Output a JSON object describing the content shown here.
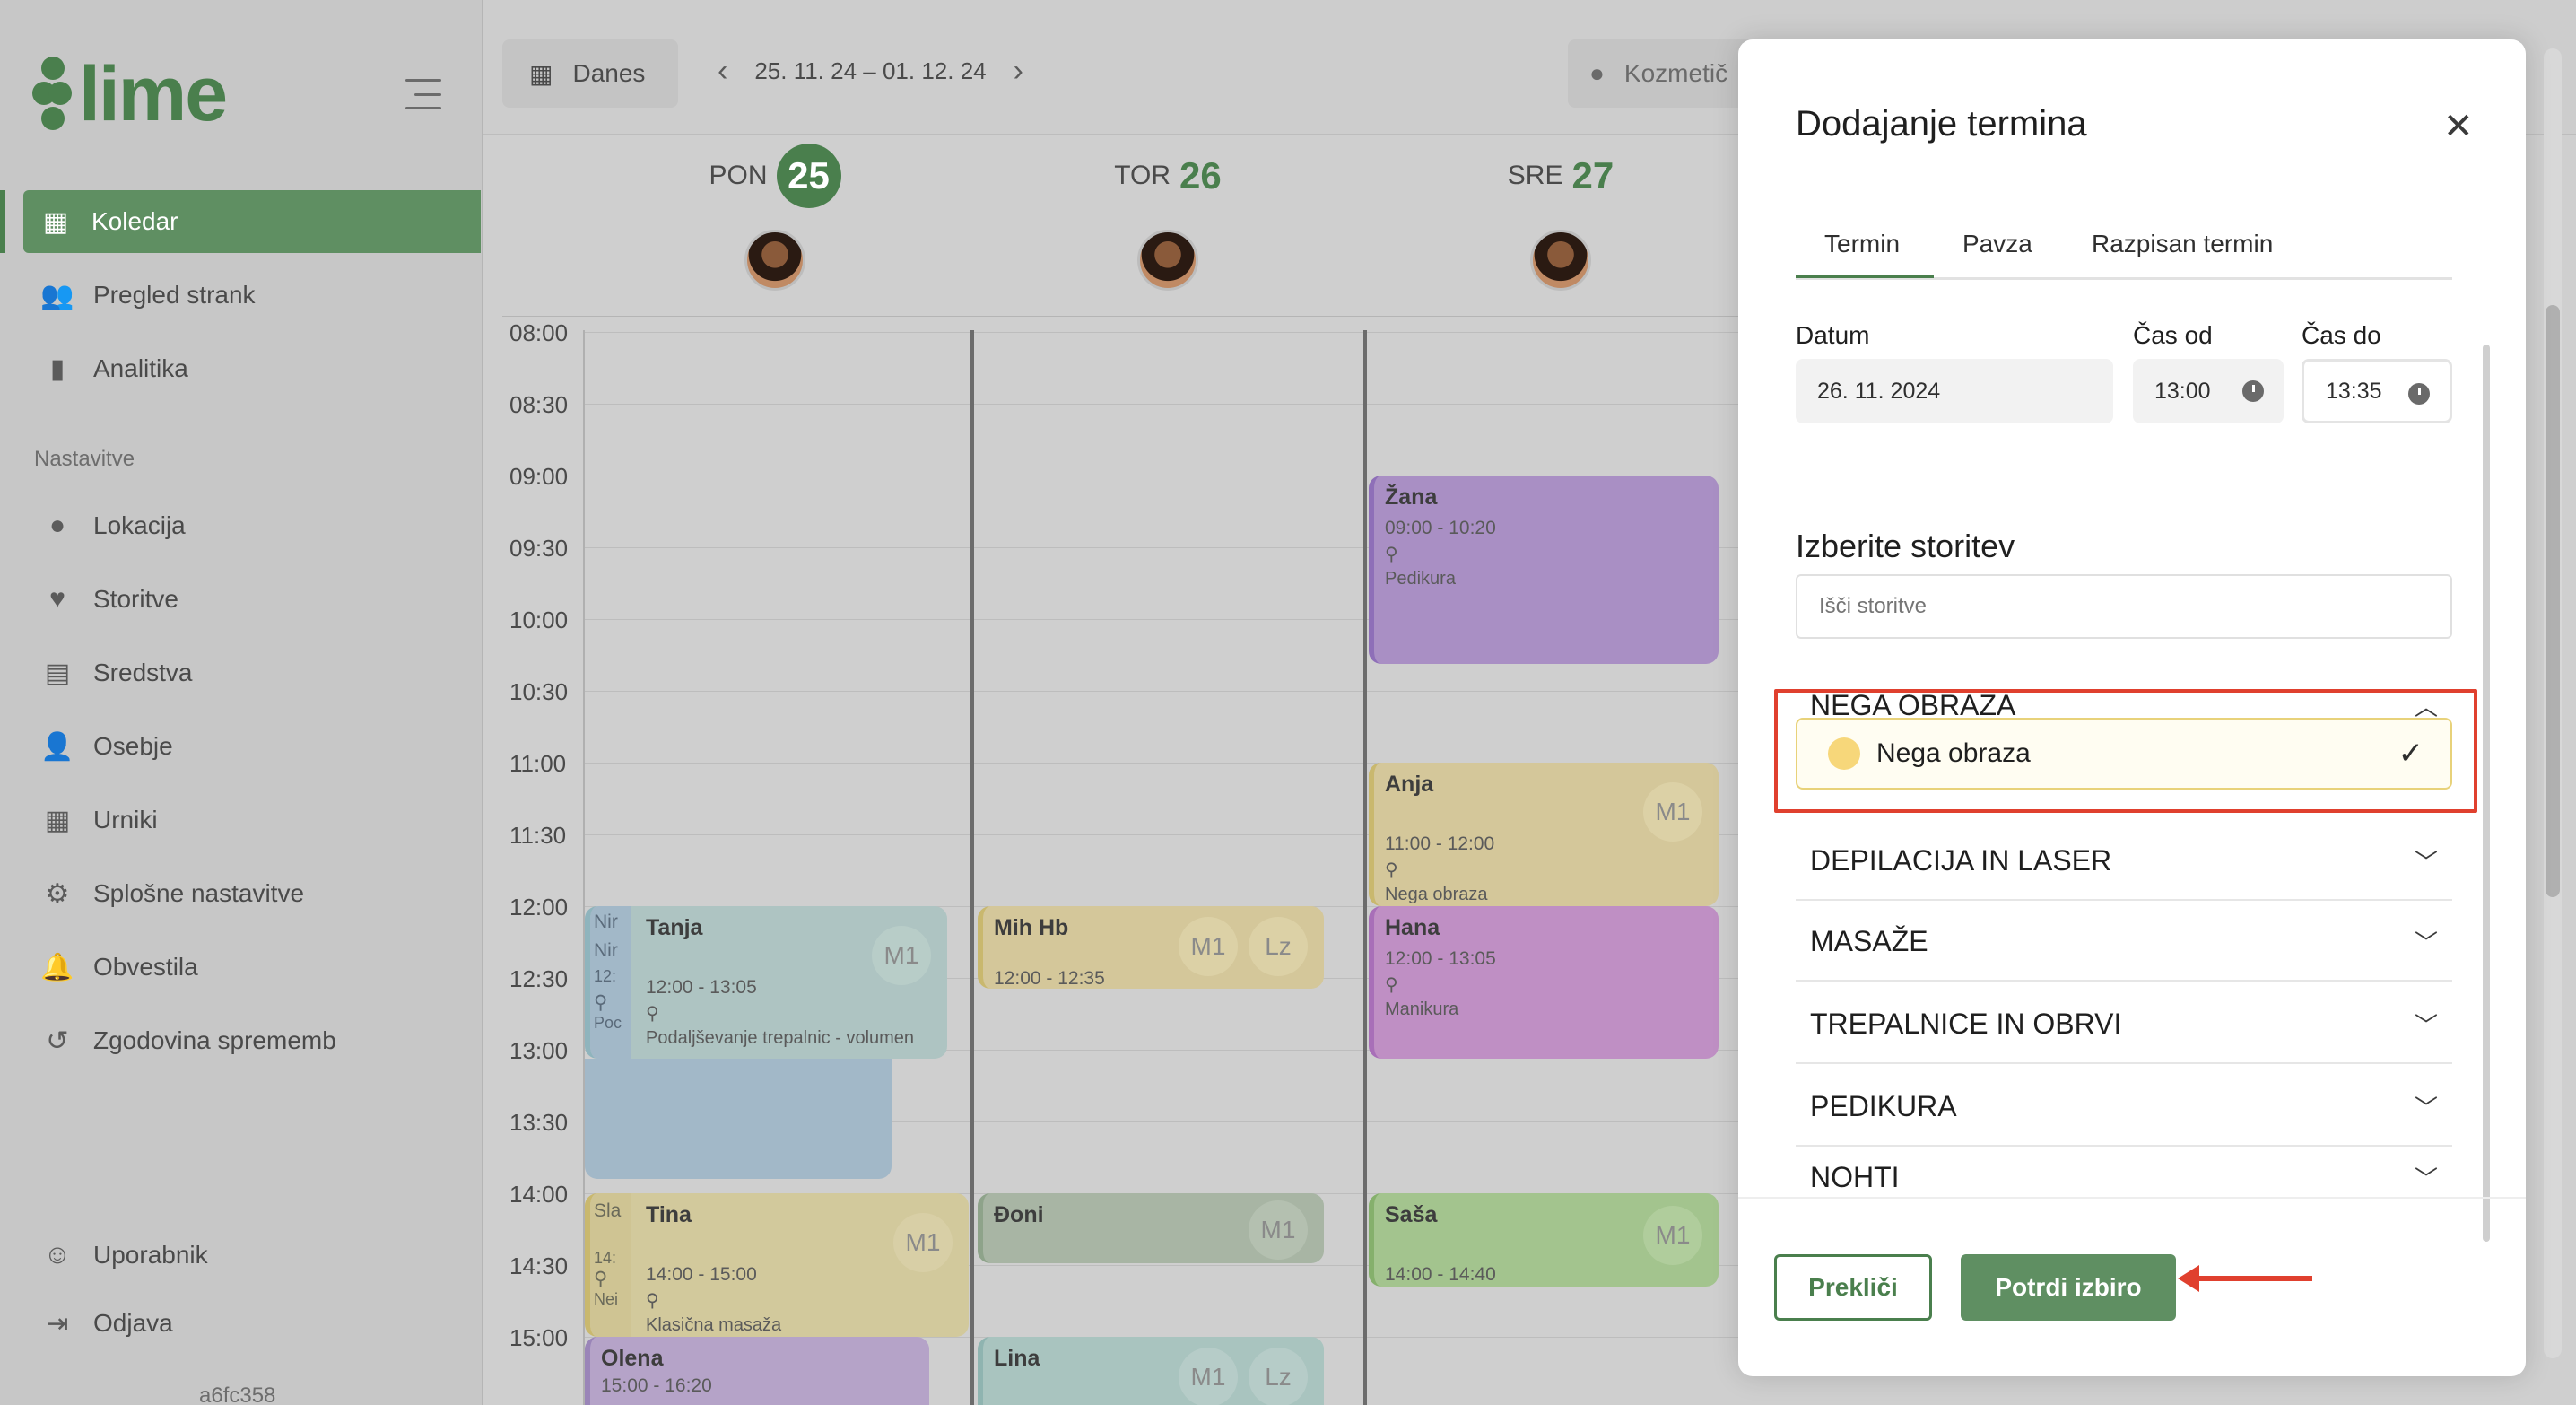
{
  "app": {
    "logo_text": "lime",
    "version": "a6fc358",
    "brand_color": "#4a7f4d"
  },
  "sidebar": {
    "items": [
      {
        "label": "Koledar",
        "icon": "calendar-icon",
        "active": true
      },
      {
        "label": "Pregled strank",
        "icon": "users-icon"
      },
      {
        "label": "Analitika",
        "icon": "bar-chart-icon"
      }
    ],
    "section_label": "Nastavitve",
    "settings_items": [
      {
        "label": "Lokacija",
        "icon": "location-pin-icon"
      },
      {
        "label": "Storitve",
        "icon": "heart-hand-icon"
      },
      {
        "label": "Sredstva",
        "icon": "building-icon"
      },
      {
        "label": "Osebje",
        "icon": "user-plus-icon"
      },
      {
        "label": "Urniki",
        "icon": "schedule-icon"
      },
      {
        "label": "Splošne nastavitve",
        "icon": "gear-icon"
      },
      {
        "label": "Obvestila",
        "icon": "bell-icon"
      },
      {
        "label": "Zgodovina sprememb",
        "icon": "history-icon"
      }
    ],
    "bottom_items": [
      {
        "label": "Uporabnik",
        "icon": "user-icon"
      },
      {
        "label": "Odjava",
        "icon": "logout-icon"
      }
    ]
  },
  "toolbar": {
    "today_label": "Danes",
    "date_range": "25. 11. 24 – 01. 12. 24",
    "location_label": "Kozmetič"
  },
  "days": [
    {
      "name": "PON",
      "num": "25",
      "today": true
    },
    {
      "name": "TOR",
      "num": "26",
      "today": false
    },
    {
      "name": "SRE",
      "num": "27",
      "today": false
    }
  ],
  "times": [
    "08:00",
    "08:30",
    "09:00",
    "09:30",
    "10:00",
    "10:30",
    "11:00",
    "11:30",
    "12:00",
    "12:30",
    "13:00",
    "13:30",
    "14:00",
    "14:30",
    "15:00"
  ],
  "events": {
    "zana": {
      "name": "Žana",
      "time": "09:00 - 10:20",
      "service": "Pedikura"
    },
    "anja": {
      "name": "Anja",
      "time": "11:00 - 12:00",
      "service": "Nega obraza",
      "tag": "M1"
    },
    "hana": {
      "name": "Hana",
      "time": "12:00 - 13:05",
      "service": "Manikura"
    },
    "sasa": {
      "name": "Saša",
      "time": "14:00 - 14:40",
      "tag": "M1"
    },
    "tanja": {
      "name": "Tanja",
      "time": "12:00 - 13:05",
      "service": "Podaljševanje trepalnic - volumen",
      "tag": "M1"
    },
    "tanja_overlap": {
      "name_a": "Nir",
      "name_b": "Nir",
      "time": "12:",
      "service": "Poc"
    },
    "tina": {
      "name": "Tina",
      "time": "14:00 - 15:00",
      "service": "Klasična masaža",
      "tag": "M1"
    },
    "tina_overlap": {
      "name": "Sla",
      "time": "14:",
      "service": "Nei"
    },
    "olena": {
      "name": "Olena",
      "time": "15:00 - 16:20"
    },
    "mihhb": {
      "name": "Mih Hb",
      "time": "12:00 - 12:35",
      "tag": "M1",
      "tag2": "Lz"
    },
    "doni": {
      "name": "Đoni",
      "tag": "M1"
    },
    "lina": {
      "name": "Lina",
      "tag": "M1",
      "tag2": "Lz"
    }
  },
  "modal": {
    "title": "Dodajanje termina",
    "tabs": [
      "Termin",
      "Pavza",
      "Razpisan termin"
    ],
    "date_label": "Datum",
    "date_value": "26. 11. 2024",
    "from_label": "Čas od",
    "from_value": "13:00",
    "to_label": "Čas do",
    "to_value": "13:35",
    "service_title": "Izberite storitev",
    "search_placeholder": "Išči storitve",
    "categories": [
      "NEGA OBRAZA",
      "DEPILACIJA IN LASER",
      "MASAŽE",
      "TREPALNICE IN OBRVI",
      "PEDIKURA",
      "NOHTI"
    ],
    "selected_service": "Nega obraza",
    "selected_service_color": "#f7d77a",
    "cancel_label": "Prekliči",
    "confirm_label": "Potrdi izbiro"
  },
  "colors": {
    "highlight": "#e0402e",
    "purple_event": "#a98fc4",
    "yellow_event": "#d4c79a",
    "pink_event": "#bf8fc4",
    "green_event": "#a3c48e",
    "teal_event": "#a9c4bf"
  }
}
